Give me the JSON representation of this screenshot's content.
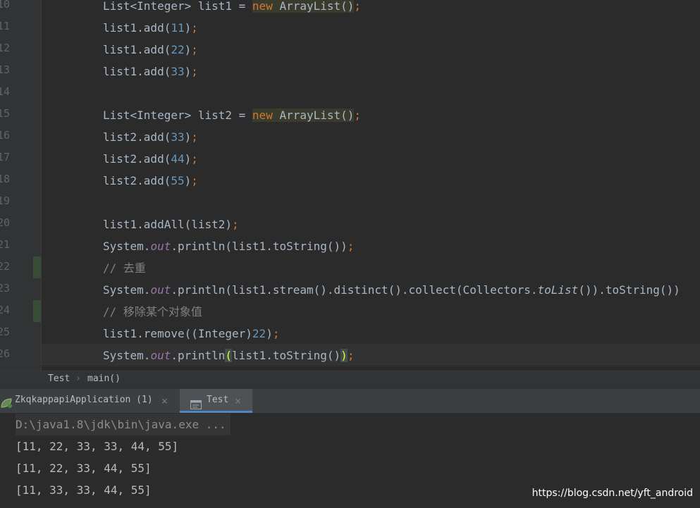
{
  "editor": {
    "line_numbers": [
      "10",
      "11",
      "12",
      "13",
      "14",
      "15",
      "16",
      "17",
      "18",
      "19",
      "20",
      "21",
      "22",
      "23",
      "24",
      "25",
      "26"
    ]
  },
  "code": {
    "l10": {
      "a": "List<Integer> list1 = ",
      "kw": "new",
      "b": " ArrayList()",
      "c": ";"
    },
    "l11": {
      "a": "list1.add(",
      "n": "11",
      "b": ")",
      "c": ";"
    },
    "l12": {
      "a": "list1.add(",
      "n": "22",
      "b": ")",
      "c": ";"
    },
    "l13": {
      "a": "list1.add(",
      "n": "33",
      "b": ")",
      "c": ";"
    },
    "l15": {
      "a": "List<Integer> list2 = ",
      "kw": "new",
      "b": " ArrayList()",
      "c": ";"
    },
    "l16": {
      "a": "list2.add(",
      "n": "33",
      "b": ")",
      "c": ";"
    },
    "l17": {
      "a": "list2.add(",
      "n": "44",
      "b": ")",
      "c": ";"
    },
    "l18": {
      "a": "list2.add(",
      "n": "55",
      "b": ")",
      "c": ";"
    },
    "l20": {
      "a": "list1.addAll(list2)",
      "c": ";"
    },
    "l21": {
      "a": "System.",
      "f": "out",
      "b": ".println(list1.toString())",
      "c": ";"
    },
    "l22": {
      "cmt": "// 去重"
    },
    "l23": {
      "a": "System.",
      "f": "out",
      "b": ".println(list1.stream().distinct().collect(Collectors.",
      "it": "toList",
      "d": "()).toString())"
    },
    "l24": {
      "cmt": "// 移除某个对象值"
    },
    "l25": {
      "a": "list1.remove((Integer)",
      "n": "22",
      "b": ")",
      "c": ";"
    },
    "l26": {
      "a": "System.",
      "f": "out",
      "b": ".println",
      "p1": "(",
      "b2": "list1.toString()",
      "p2": ")",
      "c": ";"
    }
  },
  "breadcrumb": {
    "class": "Test",
    "separator": "›",
    "method": "main()"
  },
  "run_tabs": [
    {
      "label": "ZkqkappapiApplication (1)",
      "close": "×"
    },
    {
      "label": "Test",
      "close": "×"
    }
  ],
  "console": {
    "command": "D:\\java1.8\\jdk\\bin\\java.exe ...",
    "lines": [
      "[11, 22, 33, 33, 44, 55]",
      "[11, 22, 33, 44, 55]",
      "[11, 33, 33, 44, 55]"
    ]
  },
  "watermark": "https://blog.csdn.net/yft_android",
  "colors": {
    "background": "#2b2b2b",
    "keyword": "#cc7832",
    "number": "#6897bb",
    "field": "#9876aa",
    "comment": "#808080",
    "text": "#a9b7c6",
    "tab_accent": "#4a88c7"
  },
  "icons": {
    "spring_app": "spring-leaf-icon",
    "console_tab": "console-icon"
  }
}
